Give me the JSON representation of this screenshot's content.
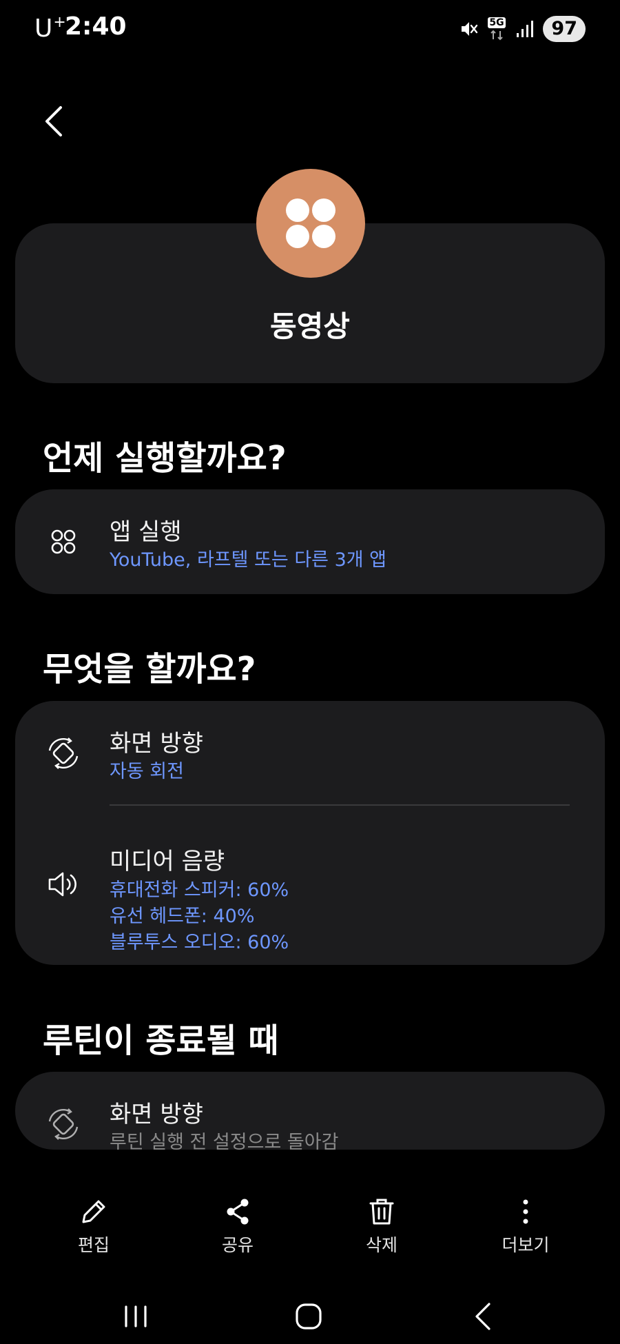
{
  "status_bar": {
    "carrier": "U",
    "carrier_sup": "+",
    "time": "2:40",
    "network": "5G",
    "battery": "97"
  },
  "routine": {
    "name": "동영상",
    "icon_color": "#d68f66",
    "icon": "four-dots-icon"
  },
  "sections": {
    "when_title": "언제 실행할까요?",
    "what_title": "무엇을 할까요?",
    "end_title": "루틴이 종료될 때"
  },
  "when": {
    "title": "앱 실행",
    "subtitle": "YouTube, 라프텔 또는 다른 3개 앱",
    "icon": "apps-icon"
  },
  "actions": [
    {
      "title": "화면 방향",
      "details": [
        "자동 회전"
      ],
      "icon": "screen-rotation-icon"
    },
    {
      "title": "미디어 음량",
      "details": [
        "휴대전화 스피커: 60%",
        "유선 헤드폰: 40%",
        "블루투스 오디오: 60%"
      ],
      "icon": "volume-icon"
    }
  ],
  "end": {
    "title": "화면 방향",
    "subtitle": "루틴 실행 전 설정으로 돌아감",
    "icon": "screen-rotation-icon"
  },
  "bottom_bar": {
    "edit": "편집",
    "share": "공유",
    "delete": "삭제",
    "more": "더보기"
  },
  "colors": {
    "background": "#000000",
    "card": "#1c1c1e",
    "accent_text": "#6e97ff",
    "routine_icon": "#d68f66"
  }
}
